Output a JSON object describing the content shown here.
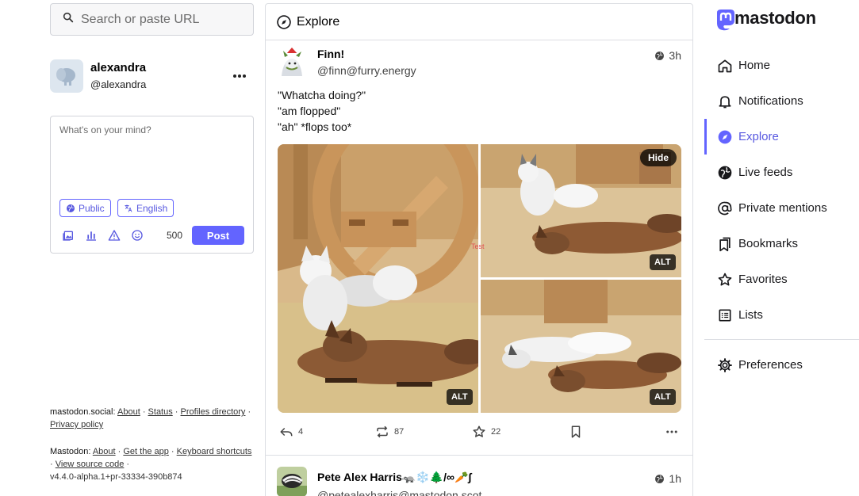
{
  "search": {
    "placeholder": "Search or paste URL"
  },
  "account": {
    "display_name": "alexandra",
    "handle": "@alexandra"
  },
  "composer": {
    "placeholder": "What's on your mind?",
    "visibility": "Public",
    "language": "English",
    "char_count": "500",
    "post_label": "Post"
  },
  "footer": {
    "server": "mastodon.social",
    "about": "About",
    "status": "Status",
    "profiles_directory": "Profiles directory",
    "privacy_policy": "Privacy policy",
    "app_name": "Mastodon",
    "about2": "About",
    "get_app": "Get the app",
    "keyboard_shortcuts": "Keyboard shortcuts",
    "view_source": "View source code",
    "version": "v4.4.0-alpha.1+pr-33334-390b874"
  },
  "column": {
    "title": "Explore"
  },
  "posts": [
    {
      "display_name": "Finn!",
      "acct": "@finn@furry.energy",
      "time": "3h",
      "lines": [
        "\"Whatcha doing?\"",
        "\"am flopped\"",
        "\"ah\" *flops too*"
      ],
      "hide_label": "Hide",
      "alt_labels": [
        "ALT",
        "ALT",
        "ALT"
      ],
      "overlay_text": "Test",
      "replies": "4",
      "boosts": "87",
      "favourites": "22"
    },
    {
      "display_name": "Pete Alex Harris🦡❄️🌲/∞🥕∫",
      "acct": "@petealexharris@mastodon.scot",
      "time": "1h"
    }
  ],
  "brand": {
    "name": "mastodon"
  },
  "nav": {
    "home": "Home",
    "notifications": "Notifications",
    "explore": "Explore",
    "live_feeds": "Live feeds",
    "private_mentions": "Private mentions",
    "bookmarks": "Bookmarks",
    "favorites": "Favorites",
    "lists": "Lists",
    "preferences": "Preferences"
  },
  "colors": {
    "accent": "#6364ff",
    "text": "#18181b",
    "border": "#dcdee3"
  }
}
